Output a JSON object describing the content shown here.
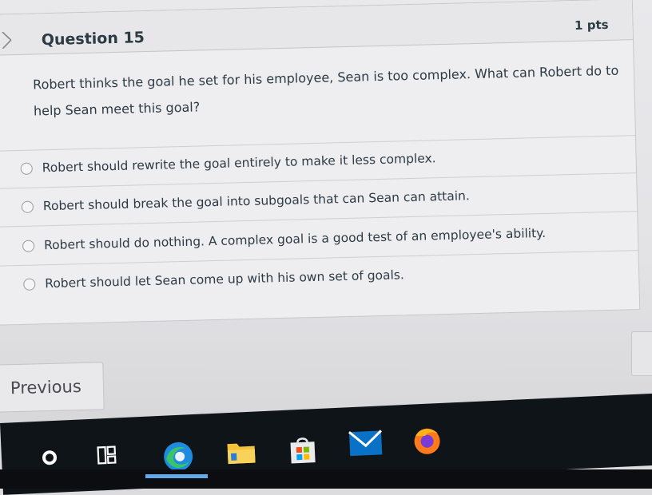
{
  "question": {
    "title": "Question 15",
    "points": "1 pts",
    "text": "Robert thinks the goal he set for his employee, Sean is too complex. What can Robert do to help Sean meet this goal?"
  },
  "answers": [
    {
      "label": "Robert should rewrite the goal entirely to make it less complex.",
      "selected": false
    },
    {
      "label": "Robert should break the goal into subgoals that can Sean can attain.",
      "selected": false
    },
    {
      "label": "Robert should do nothing. A complex goal is a good test of an employee's ability.",
      "selected": false
    },
    {
      "label": "Robert should let Sean come up with his own set of goals.",
      "selected": false
    }
  ],
  "navigation": {
    "previous_label": "Previous"
  },
  "taskbar": {
    "items": [
      {
        "name": "search-icon"
      },
      {
        "name": "task-view-icon"
      },
      {
        "name": "edge-icon"
      },
      {
        "name": "file-explorer-icon"
      },
      {
        "name": "store-icon"
      },
      {
        "name": "mail-icon"
      },
      {
        "name": "firefox-icon"
      }
    ]
  },
  "colors": {
    "text": "#2d3b45",
    "page_bg": "#eeeef0",
    "taskbar": "#0f1418",
    "edge_blue": "#1f8be0",
    "explorer_yellow": "#f3c23a",
    "mail_blue": "#0a72c6",
    "firefox_orange": "#ff7a1a"
  }
}
